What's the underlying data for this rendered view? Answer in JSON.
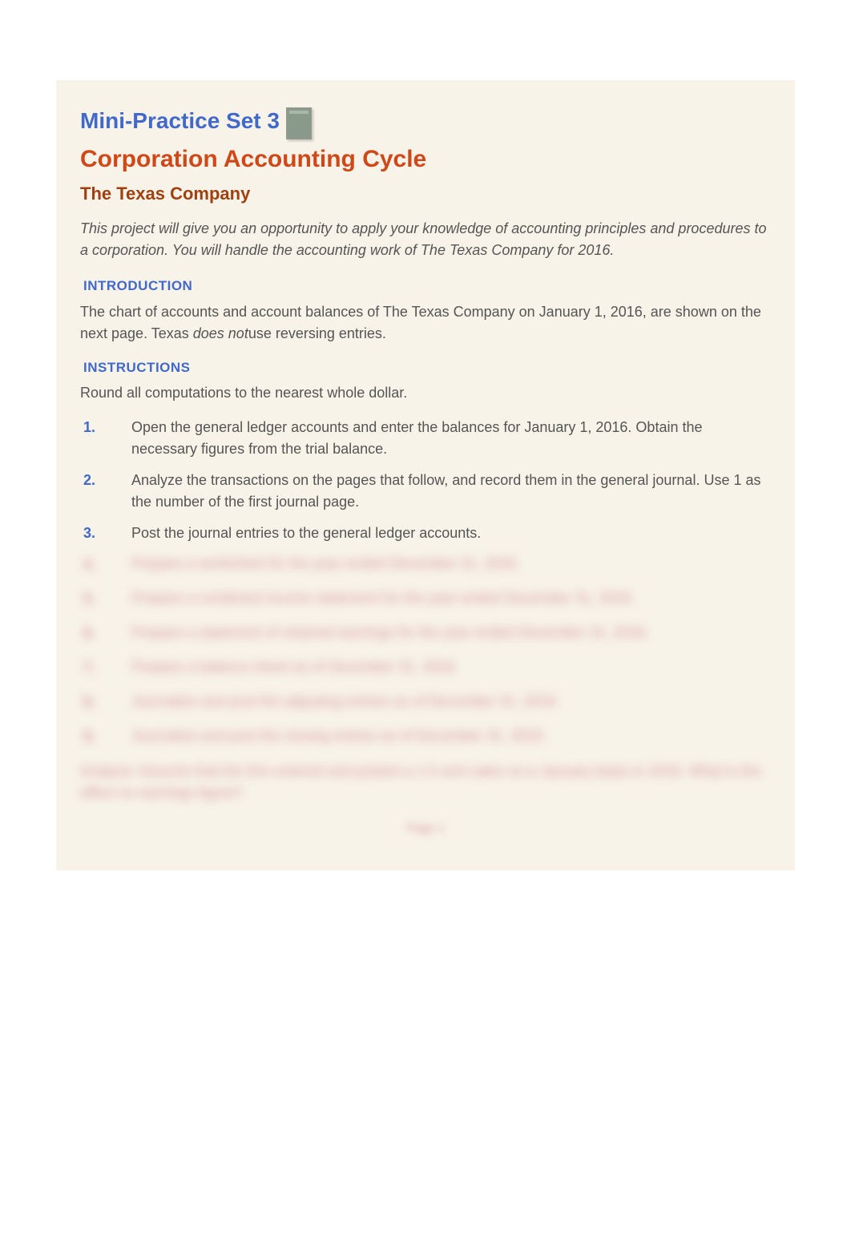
{
  "title1": "Mini-Practice Set 3",
  "title2": "Corporation Accounting Cycle",
  "title3": "The Texas Company",
  "intro": "This project will give you an opportunity to apply your knowledge of accounting principles and procedures to a corporation. You will handle the accounting work of The Texas Company for 2016.",
  "section_intro_heading": "INTRODUCTION",
  "intro_body_pre": "The chart of accounts and account balances of The Texas Company on January 1, 2016, are shown on the next page. Texas ",
  "does_not": "does not",
  "intro_body_post": "use reversing entries.",
  "section_instructions_heading": "INSTRUCTIONS",
  "instructions_lead": "Round all computations to the nearest whole dollar.",
  "instructions": [
    {
      "num": "1.",
      "text": "Open the general ledger accounts and enter the balances for January 1, 2016. Obtain the necessary figures from the trial balance."
    },
    {
      "num": "2.",
      "text": "Analyze the transactions on the pages that follow, and record them in the general journal. Use 1 as the number of the first journal page."
    },
    {
      "num": "3.",
      "text": "Post the journal entries to the general ledger accounts."
    }
  ],
  "blurred_items": [
    {
      "num": "4.",
      "text": "Prepare a worksheet for the year ended December 31, 2016."
    },
    {
      "num": "5.",
      "text": "Prepare a combined income statement for the year ended December 31, 2016."
    },
    {
      "num": "6.",
      "text": "Prepare a statement of retained earnings for the year ended December 31, 2016."
    },
    {
      "num": "7.",
      "text": "Prepare a balance sheet as of December 31, 2016."
    },
    {
      "num": "8.",
      "text": "Journalize and post the adjusting entries as of December 31, 2016."
    },
    {
      "num": "9.",
      "text": "Journalize and post the closing entries as of December 31, 2016."
    }
  ],
  "blurred_para": "Analyze: Assume that the firm entered and posted a 1.5 cent sales on a January basis in 2016. What is the effect on earnings figure?",
  "page_number": "Page 1"
}
